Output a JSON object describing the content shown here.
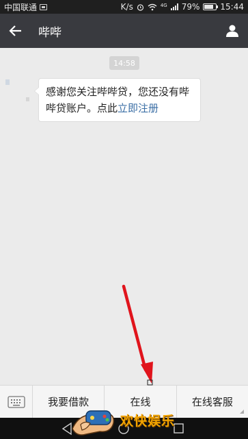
{
  "status_bar": {
    "carrier": "中国联通",
    "speed": "K/s",
    "network": "4G",
    "battery": "79%",
    "battery_level": 0.79,
    "time": "15:44"
  },
  "title_bar": {
    "title": "哔哔"
  },
  "chat": {
    "timestamp": "14:58",
    "message_text": "感谢您关注哔哔贷，您还没有哔哔贷账户。点此",
    "message_link": "立即注册"
  },
  "bottom_menu": {
    "items": [
      "我要借款",
      "在线",
      "在线客服"
    ]
  },
  "watermark": {
    "text": "欢快娱乐"
  },
  "colors": {
    "title_bar": "#393a3f",
    "chat_bg": "#ebebeb",
    "link": "#3a6ea5",
    "arrow": "#e0141c",
    "watermark_text": "#f2a400"
  }
}
